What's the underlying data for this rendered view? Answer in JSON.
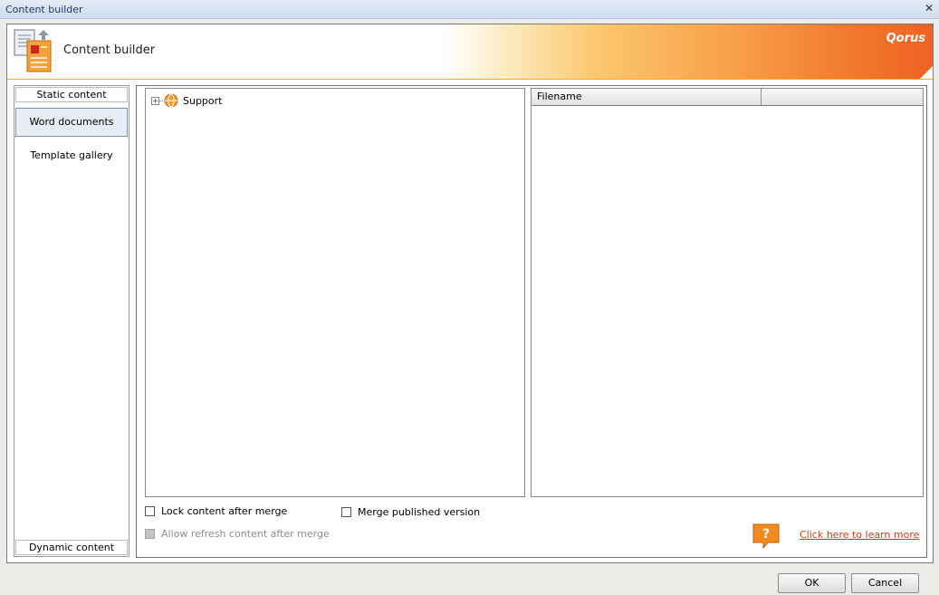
{
  "window": {
    "title": "Content builder",
    "close_icon": "close-icon"
  },
  "header": {
    "heading": "Content builder",
    "brand": "Qorus",
    "app_icon": "content-builder-icon"
  },
  "sidebar": {
    "sections": {
      "static": "Static content",
      "dynamic": "Dynamic content"
    },
    "items": [
      {
        "label": "Word documents",
        "selected": true
      },
      {
        "label": "Template gallery",
        "selected": false
      }
    ]
  },
  "tree": {
    "nodes": [
      {
        "label": "Support",
        "expander": "+",
        "icon": "orange-globe-icon"
      }
    ]
  },
  "grid": {
    "columns": [
      "Filename",
      ""
    ],
    "rows": []
  },
  "options": {
    "lock_content": {
      "label": "Lock content after merge",
      "checked": false,
      "enabled": true
    },
    "merge_published": {
      "label": "Merge published version",
      "checked": false,
      "enabled": true
    },
    "allow_refresh": {
      "label": "Allow refresh content after merge",
      "checked": false,
      "enabled": false
    }
  },
  "help": {
    "link_text": "Click here to learn more",
    "icon": "help-question-icon"
  },
  "buttons": {
    "ok": "OK",
    "cancel": "Cancel"
  },
  "colors": {
    "accent": "#ee6223",
    "link": "#c4421a",
    "selection": "#e7ecf5"
  }
}
